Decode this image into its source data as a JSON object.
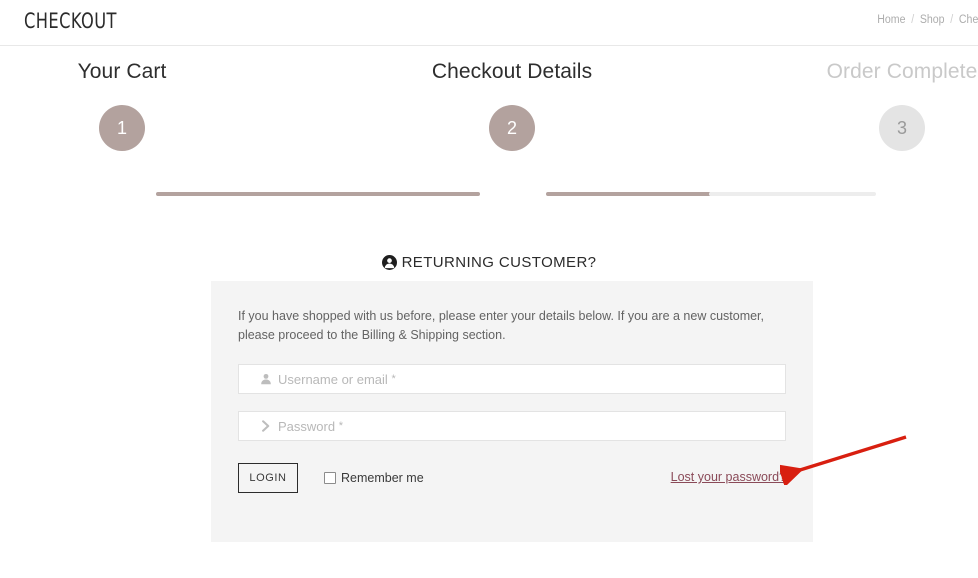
{
  "header": {
    "title": "CHECKOUT",
    "breadcrumb": {
      "items": [
        "Home",
        "Shop",
        "Chec"
      ],
      "separator": "/"
    }
  },
  "progress": {
    "steps": [
      {
        "number": "1",
        "label": "Your Cart",
        "state": "complete"
      },
      {
        "number": "2",
        "label": "Checkout Details",
        "state": "active"
      },
      {
        "number": "3",
        "label": "Order Complete",
        "state": "inactive"
      }
    ],
    "active_color": "#b3a29e",
    "inactive_color": "#e4e4e4",
    "bar_empty_color": "#ededed"
  },
  "returning_customer": {
    "heading": "RETURNING CUSTOMER?",
    "icon": "user-circle-icon"
  },
  "login_form": {
    "intro": "If you have shopped with us before, please enter your details below. If you are a new customer, please proceed to the Billing & Shipping section.",
    "username": {
      "icon": "user-icon",
      "placeholder": "Username or email",
      "required_mark": "*",
      "value": ""
    },
    "password": {
      "icon": "chevron-right-icon",
      "placeholder": "Password",
      "required_mark": "*",
      "value": ""
    },
    "login_button": "LOGIN",
    "remember_me": {
      "label": "Remember me",
      "checked": false
    },
    "lost_password": "Lost your password?",
    "lost_password_color": "#8a4a58",
    "panel_background": "#f4f4f4"
  },
  "annotation": {
    "arrow_color": "#d81f10",
    "points_to": "Lost your password?"
  }
}
